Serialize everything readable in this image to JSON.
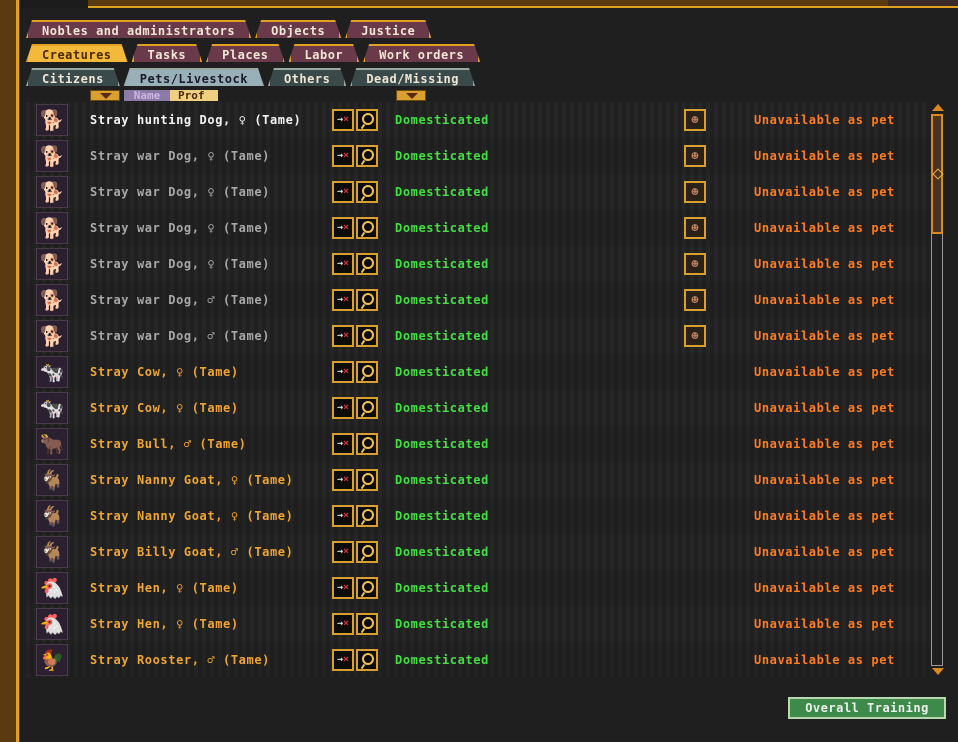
{
  "tabs": {
    "row1": [
      {
        "label": "Nobles and administrators"
      },
      {
        "label": "Objects"
      },
      {
        "label": "Justice"
      }
    ],
    "row2": [
      {
        "label": "Creatures",
        "active": true
      },
      {
        "label": "Tasks"
      },
      {
        "label": "Places"
      },
      {
        "label": "Labor"
      },
      {
        "label": "Work orders"
      }
    ],
    "row3": [
      {
        "label": "Citizens"
      },
      {
        "label": "Pets/Livestock",
        "active": true
      },
      {
        "label": "Others"
      },
      {
        "label": "Dead/Missing"
      }
    ]
  },
  "sort": {
    "name_label": "Name",
    "prof_label": "Prof",
    "selected": "Name"
  },
  "creatures": [
    {
      "name": "Stray hunting Dog, ♀ (Tame)",
      "status": "Domesticated",
      "availability": "Unavailable as pet",
      "icon": "dog-icon",
      "color": "white",
      "has_owner": true
    },
    {
      "name": "Stray war Dog, ♀ (Tame)",
      "status": "Domesticated",
      "availability": "Unavailable as pet",
      "icon": "war-dog-icon",
      "color": "gray",
      "has_owner": true
    },
    {
      "name": "Stray war Dog, ♀ (Tame)",
      "status": "Domesticated",
      "availability": "Unavailable as pet",
      "icon": "war-dog-icon",
      "color": "gray",
      "has_owner": true
    },
    {
      "name": "Stray war Dog, ♀ (Tame)",
      "status": "Domesticated",
      "availability": "Unavailable as pet",
      "icon": "war-dog-icon",
      "color": "gray",
      "has_owner": true
    },
    {
      "name": "Stray war Dog, ♀ (Tame)",
      "status": "Domesticated",
      "availability": "Unavailable as pet",
      "icon": "war-dog-icon",
      "color": "gray",
      "has_owner": true
    },
    {
      "name": "Stray war Dog, ♂ (Tame)",
      "status": "Domesticated",
      "availability": "Unavailable as pet",
      "icon": "war-dog-icon",
      "color": "gray",
      "has_owner": true
    },
    {
      "name": "Stray war Dog, ♂ (Tame)",
      "status": "Domesticated",
      "availability": "Unavailable as pet",
      "icon": "war-dog-icon",
      "color": "gray",
      "has_owner": true
    },
    {
      "name": "Stray Cow, ♀ (Tame)",
      "status": "Domesticated",
      "availability": "Unavailable as pet",
      "icon": "cow-icon",
      "color": "gold",
      "has_owner": false
    },
    {
      "name": "Stray Cow, ♀ (Tame)",
      "status": "Domesticated",
      "availability": "Unavailable as pet",
      "icon": "cow-icon",
      "color": "gold",
      "has_owner": false
    },
    {
      "name": "Stray Bull, ♂ (Tame)",
      "status": "Domesticated",
      "availability": "Unavailable as pet",
      "icon": "bull-icon",
      "color": "gold",
      "has_owner": false
    },
    {
      "name": "Stray Nanny Goat, ♀ (Tame)",
      "status": "Domesticated",
      "availability": "Unavailable as pet",
      "icon": "goat-icon",
      "color": "gold",
      "has_owner": false
    },
    {
      "name": "Stray Nanny Goat, ♀ (Tame)",
      "status": "Domesticated",
      "availability": "Unavailable as pet",
      "icon": "goat-icon",
      "color": "gold",
      "has_owner": false
    },
    {
      "name": "Stray Billy Goat, ♂ (Tame)",
      "status": "Domesticated",
      "availability": "Unavailable as pet",
      "icon": "goat-icon",
      "color": "gold",
      "has_owner": false
    },
    {
      "name": "Stray Hen, ♀ (Tame)",
      "status": "Domesticated",
      "availability": "Unavailable as pet",
      "icon": "hen-icon",
      "color": "gold",
      "has_owner": false
    },
    {
      "name": "Stray Hen, ♀ (Tame)",
      "status": "Domesticated",
      "availability": "Unavailable as pet",
      "icon": "hen-icon",
      "color": "gold",
      "has_owner": false
    },
    {
      "name": "Stray Rooster, ♂ (Tame)",
      "status": "Domesticated",
      "availability": "Unavailable as pet",
      "icon": "rooster-icon",
      "color": "gold",
      "has_owner": false
    }
  ],
  "footer": {
    "overall_training_label": "Overall Training"
  },
  "colors": {
    "accent": "#e0a020",
    "status_green": "#40e040",
    "availability_orange": "#ff7a20",
    "name_gold": "#f0a530",
    "training_button": "#3e8a4a"
  }
}
